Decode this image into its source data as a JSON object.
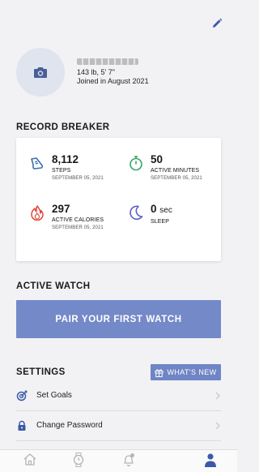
{
  "profile": {
    "stats": "143 lb, 5' 7\"",
    "joined": "Joined in August 2021"
  },
  "record_breaker": {
    "title": "RECORD BREAKER",
    "records": [
      {
        "icon": "steps-icon",
        "value": "8,112",
        "unit": "",
        "label": "STEPS",
        "date": "SEPTEMBER 05, 2021"
      },
      {
        "icon": "stopwatch-icon",
        "value": "50",
        "unit": "",
        "label": "ACTIVE MINUTES",
        "date": "SEPTEMBER 05, 2021"
      },
      {
        "icon": "flame-icon",
        "value": "297",
        "unit": "",
        "label": "ACTIVE CALORIES",
        "date": "SEPTEMBER 05, 2021"
      },
      {
        "icon": "moon-icon",
        "value": "0",
        "unit": "sec",
        "label": "SLEEP",
        "date": ""
      }
    ]
  },
  "active_watch": {
    "title": "ACTIVE WATCH",
    "pair_label": "PAIR YOUR FIRST WATCH"
  },
  "settings": {
    "title": "SETTINGS",
    "whats_new": "WHAT'S NEW",
    "items": [
      {
        "label": "Set Goals",
        "icon": "goals-icon"
      },
      {
        "label": "Change Password",
        "icon": "lock-icon"
      }
    ]
  },
  "colors": {
    "accent": "#7489c8",
    "accent_dark": "#3a5aa8",
    "steps": "#3a6fb5",
    "minutes": "#3aa36b",
    "calories": "#e0463b",
    "sleep": "#5a5fc8"
  }
}
